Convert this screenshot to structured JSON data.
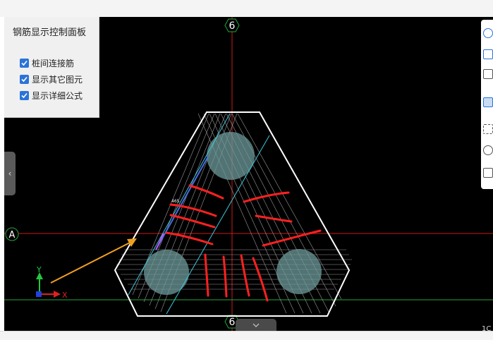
{
  "panel": {
    "title": "钢筋显示控制面板",
    "options": [
      {
        "label": "桩间连接筋",
        "checked": true
      },
      {
        "label": "显示其它图元",
        "checked": true
      },
      {
        "label": "显示详细公式",
        "checked": true
      }
    ]
  },
  "axes": {
    "vertical_label": "6",
    "vertical_label_bottom": "6",
    "horizontal_label": "A",
    "y_axis": "Y",
    "x_axis": "X"
  },
  "dimension_text": "465",
  "corner_text": "1C",
  "colors": {
    "background": "#000000",
    "axis_red": "#d01818",
    "axis_green": "#22a83a",
    "outline": "#ffffff",
    "cyan_rebar": "#3cc8dc",
    "markup_red": "#ff2020",
    "arrow_orange": "#f0a020",
    "accent_blue": "#2a74d8"
  },
  "icons": {
    "collapse_left": "chevron-left-icon",
    "collapse_bottom": "chevron-down-icon",
    "toolbar": [
      "cloud-view-icon",
      "2d-view-icon",
      "box-view-icon",
      "box-solid-icon",
      "select-frame-icon",
      "rotate-3d-icon",
      "list-icon"
    ]
  }
}
